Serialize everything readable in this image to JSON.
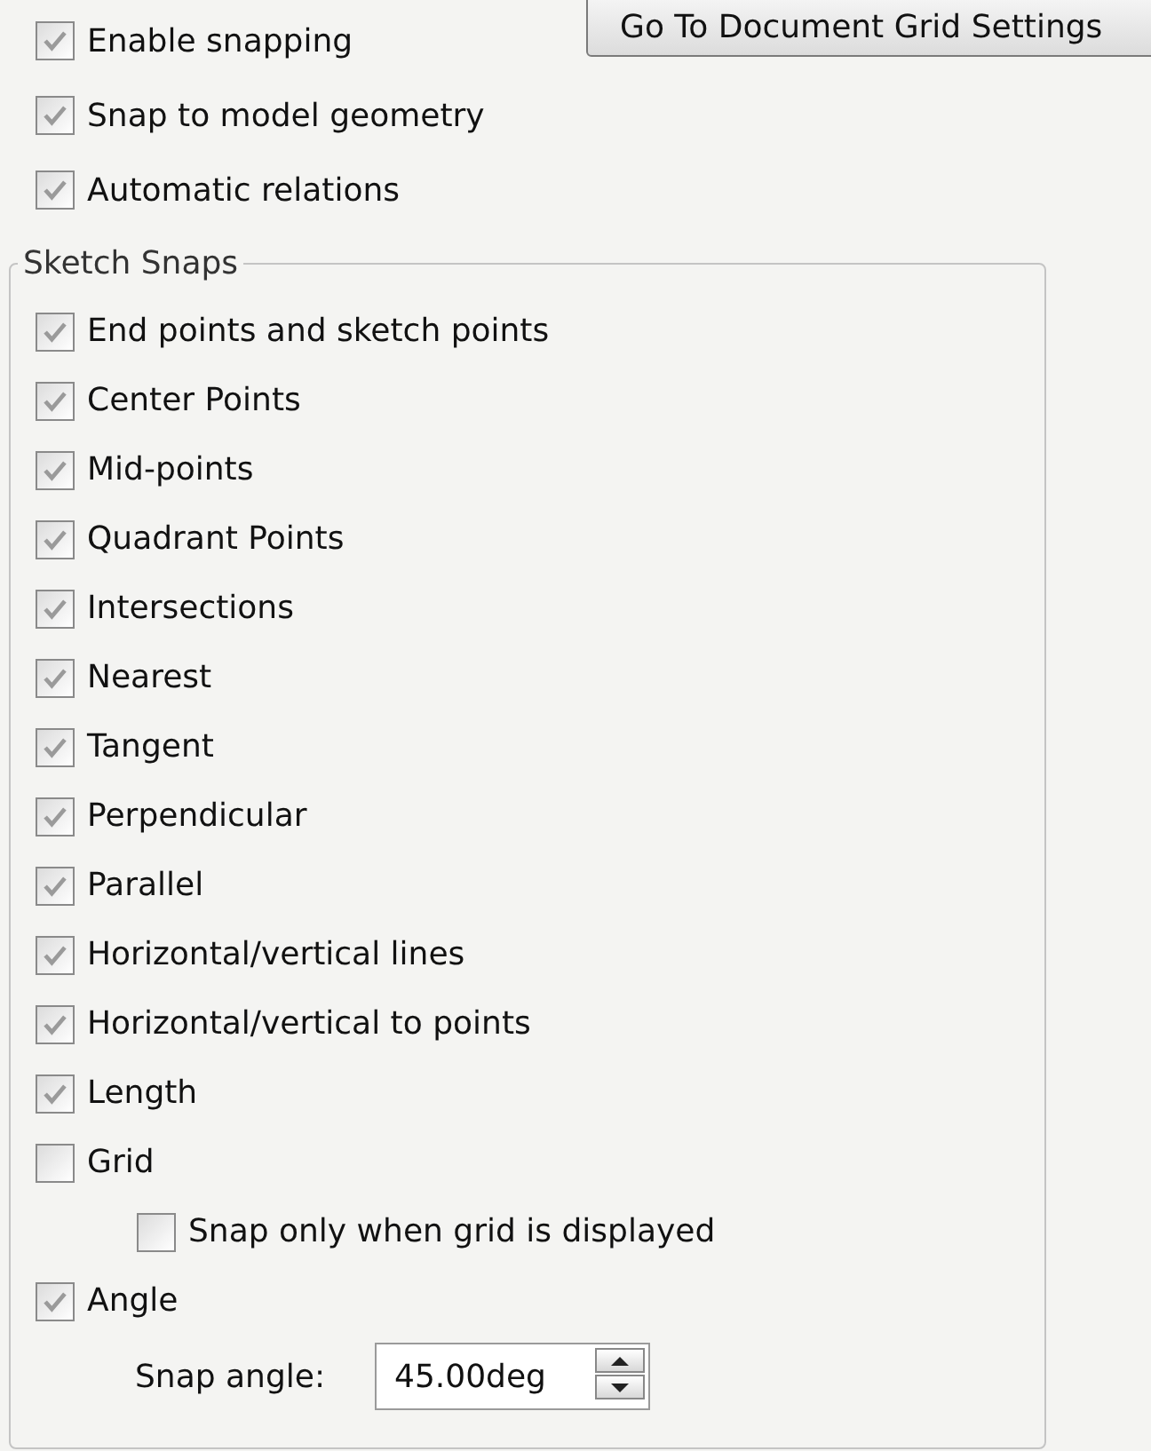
{
  "options": [
    {
      "label": "Enable snapping",
      "checked": true
    },
    {
      "label": "Snap to model geometry",
      "checked": true
    },
    {
      "label": "Automatic relations",
      "checked": true
    }
  ],
  "grid_button": {
    "label": "Go To Document Grid Settings"
  },
  "sketch_snaps": {
    "title": "Sketch Snaps",
    "items": [
      {
        "label": "End points and sketch points",
        "checked": true
      },
      {
        "label": "Center Points",
        "checked": true
      },
      {
        "label": "Mid-points",
        "checked": true
      },
      {
        "label": "Quadrant Points",
        "checked": true
      },
      {
        "label": "Intersections",
        "checked": true
      },
      {
        "label": "Nearest",
        "checked": true
      },
      {
        "label": "Tangent",
        "checked": true
      },
      {
        "label": "Perpendicular",
        "checked": true
      },
      {
        "label": "Parallel",
        "checked": true
      },
      {
        "label": "Horizontal/vertical lines",
        "checked": true
      },
      {
        "label": "Horizontal/vertical to points",
        "checked": true
      },
      {
        "label": "Length",
        "checked": true
      },
      {
        "label": "Grid",
        "checked": false,
        "children": [
          {
            "label": "Snap only when grid is displayed",
            "checked": false
          }
        ]
      },
      {
        "label": "Angle",
        "checked": true
      }
    ],
    "snap_angle": {
      "label": "Snap angle:",
      "value": "45.00deg"
    }
  }
}
